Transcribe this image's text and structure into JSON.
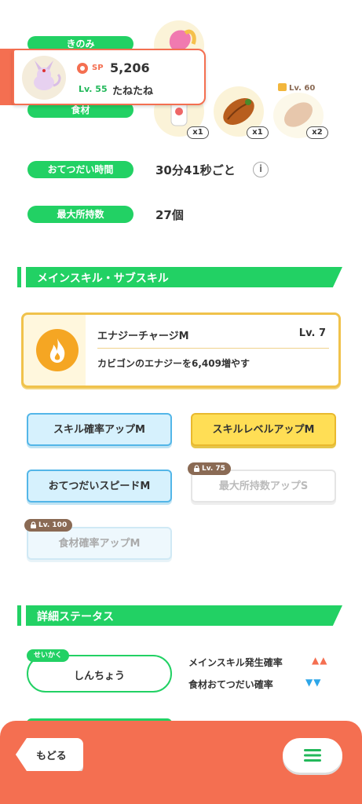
{
  "profile": {
    "sp_label": "SP",
    "sp_value": "5,206",
    "level": "Lv. 55",
    "name": "たねたね"
  },
  "stats": {
    "berry_label": "きのみ",
    "ingredient_label": "食材",
    "ingredients": [
      {
        "count": "x1",
        "lock": ""
      },
      {
        "count": "x1",
        "lock": ""
      },
      {
        "count": "x2",
        "lock": "Lv. 60"
      }
    ],
    "help_time_label": "おてつだい時間",
    "help_time_value": "30分41秒ごと",
    "max_carry_label": "最大所持数",
    "max_carry_value": "27個"
  },
  "main_skill_section": {
    "title": "メインスキル・サブスキル",
    "skill_name": "エナジーチャージM",
    "skill_level": "Lv. 7",
    "skill_desc": "カビゴンのエナジーを6,409増やす"
  },
  "sub_skills": [
    {
      "label": "スキル確率アップM",
      "lock": ""
    },
    {
      "label": "スキルレベルアップM",
      "lock": ""
    },
    {
      "label": "おてつだいスピードM",
      "lock": ""
    },
    {
      "label": "最大所持数アップS",
      "lock": "Lv. 75"
    },
    {
      "label": "食材確率アップM",
      "lock": "Lv. 100"
    }
  ],
  "detail_section": {
    "title": "詳細ステータス",
    "nature_tag": "せいかく",
    "nature_value": "しんちょう",
    "effect_up_label": "メインスキル発生確率",
    "effect_up_marks": "▲▲",
    "effect_down_label": "食材おてつだい確率",
    "effect_down_marks": "▼▼"
  },
  "footer": {
    "back_label": "もどる"
  },
  "colors": {
    "accent_green": "#22d164",
    "footer_orange": "#f46f51",
    "up_red": "#f46f51",
    "down_blue": "#2ea6e8"
  }
}
